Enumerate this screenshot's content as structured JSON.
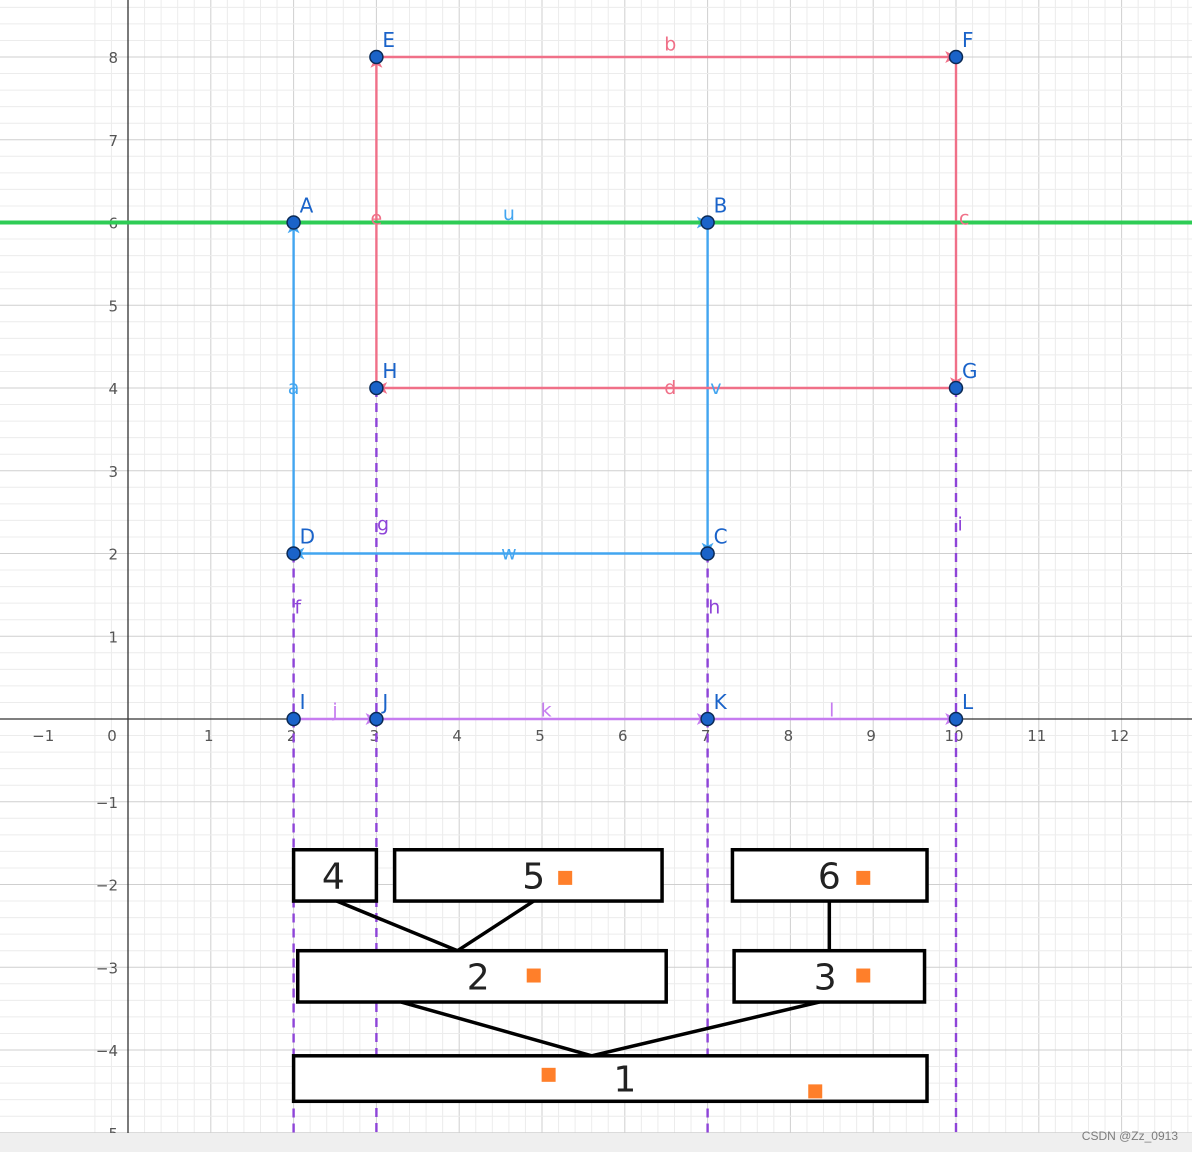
{
  "graph": {
    "x_ticks": [
      -1,
      0,
      1,
      2,
      3,
      4,
      5,
      6,
      7,
      8,
      9,
      10,
      11,
      12
    ],
    "y_ticks": [
      -5,
      -4,
      -3,
      -2,
      -1,
      1,
      2,
      3,
      4,
      5,
      6,
      7,
      8
    ],
    "x_tick_labels": [
      "−1",
      "0",
      "1",
      "2",
      "3",
      "4",
      "5",
      "6",
      "7",
      "8",
      "9",
      "10",
      "11",
      "12"
    ],
    "y_tick_labels": [
      "−5",
      "−4",
      "−3",
      "−2",
      "−1",
      "1",
      "2",
      "3",
      "4",
      "5",
      "6",
      "7",
      "8"
    ],
    "colors": {
      "red": "#f07088",
      "blue": "#42a5f0",
      "purple": "#c67cf0",
      "purple_dashed": "#8e44d8",
      "green": "#2ecc55",
      "point": "#1a63c9",
      "label": "#1a63c9",
      "orange": "#ff7f2a",
      "box": "#000000"
    },
    "points": [
      {
        "name": "A",
        "x": 2,
        "y": 6
      },
      {
        "name": "B",
        "x": 7,
        "y": 6
      },
      {
        "name": "C",
        "x": 7,
        "y": 2
      },
      {
        "name": "D",
        "x": 2,
        "y": 2
      },
      {
        "name": "E",
        "x": 3,
        "y": 8
      },
      {
        "name": "F",
        "x": 10,
        "y": 8
      },
      {
        "name": "G",
        "x": 10,
        "y": 4
      },
      {
        "name": "H",
        "x": 3,
        "y": 4
      },
      {
        "name": "I",
        "x": 2,
        "y": 0
      },
      {
        "name": "J",
        "x": 3,
        "y": 0
      },
      {
        "name": "K",
        "x": 7,
        "y": 0
      },
      {
        "name": "L",
        "x": 10,
        "y": 0
      }
    ],
    "vectors": [
      {
        "name": "a",
        "from": [
          2,
          2
        ],
        "to": [
          2,
          6
        ],
        "color": "blue",
        "lx": 2,
        "ly": 4
      },
      {
        "name": "u",
        "from": [
          2,
          6
        ],
        "to": [
          7,
          6
        ],
        "color": "blue",
        "lx": 4.6,
        "ly": 6.1
      },
      {
        "name": "v",
        "from": [
          7,
          6
        ],
        "to": [
          7,
          2
        ],
        "color": "blue",
        "lx": 7.1,
        "ly": 4
      },
      {
        "name": "w",
        "from": [
          7,
          2
        ],
        "to": [
          2,
          2
        ],
        "color": "blue",
        "lx": 4.6,
        "ly": 2
      },
      {
        "name": "b",
        "from": [
          3,
          8
        ],
        "to": [
          10,
          8
        ],
        "color": "red",
        "lx": 6.55,
        "ly": 8.15
      },
      {
        "name": "c",
        "from": [
          10,
          8
        ],
        "to": [
          10,
          4
        ],
        "color": "red",
        "lx": 10.1,
        "ly": 6.05
      },
      {
        "name": "d",
        "from": [
          10,
          4
        ],
        "to": [
          3,
          4
        ],
        "color": "red",
        "lx": 6.55,
        "ly": 4
      },
      {
        "name": "e",
        "from": [
          3,
          4
        ],
        "to": [
          3,
          8
        ],
        "color": "red",
        "lx": 3,
        "ly": 6.05
      },
      {
        "name": "j",
        "from": [
          2,
          0
        ],
        "to": [
          3,
          0
        ],
        "color": "purple",
        "lx": 2.5,
        "ly": 0.1
      },
      {
        "name": "k",
        "from": [
          3,
          0
        ],
        "to": [
          7,
          0
        ],
        "color": "purple",
        "lx": 5.05,
        "ly": 0.1
      },
      {
        "name": "l",
        "from": [
          7,
          0
        ],
        "to": [
          10,
          0
        ],
        "color": "purple",
        "lx": 8.5,
        "ly": 0.1
      }
    ],
    "dashed_lines": [
      {
        "name": "f",
        "x": 2,
        "lx": 2.05,
        "ly": 1.35
      },
      {
        "name": "g",
        "x": 3,
        "lx": 3.08,
        "ly": 2.35
      },
      {
        "name": "h",
        "x": 7,
        "lx": 7.08,
        "ly": 1.35
      },
      {
        "name": "i",
        "x": 10,
        "lx": 10.05,
        "ly": 2.35
      }
    ],
    "green_line": {
      "y": 6
    },
    "boxes": [
      {
        "label": "4",
        "x1": 2.0,
        "x2": 3.0,
        "y1": -1.58,
        "y2": -2.2,
        "tx": 2.48,
        "markers": []
      },
      {
        "label": "5",
        "x1": 3.22,
        "x2": 6.45,
        "y1": -1.58,
        "y2": -2.2,
        "tx": 4.9,
        "markers": [
          [
            5.28,
            -1.92
          ]
        ]
      },
      {
        "label": "6",
        "x1": 7.3,
        "x2": 9.65,
        "y1": -1.58,
        "y2": -2.2,
        "tx": 8.47,
        "markers": [
          [
            8.88,
            -1.92
          ]
        ]
      },
      {
        "label": "2",
        "x1": 2.05,
        "x2": 6.5,
        "y1": -2.8,
        "y2": -3.42,
        "tx": 4.23,
        "markers": [
          [
            4.9,
            -3.1
          ]
        ]
      },
      {
        "label": "3",
        "x1": 7.32,
        "x2": 9.62,
        "y1": -2.8,
        "y2": -3.42,
        "tx": 8.42,
        "markers": [
          [
            8.88,
            -3.1
          ]
        ]
      },
      {
        "label": "1",
        "x1": 2.0,
        "x2": 9.65,
        "y1": -4.07,
        "y2": -4.62,
        "tx": 6.0,
        "markers": [
          [
            5.08,
            -4.3
          ],
          [
            8.3,
            -4.5
          ]
        ]
      }
    ],
    "connectors": [
      {
        "from": [
          2.52,
          -2.2
        ],
        "to": [
          3.98,
          -2.8
        ]
      },
      {
        "from": [
          4.9,
          -2.2
        ],
        "to": [
          3.98,
          -2.8
        ]
      },
      {
        "from": [
          8.47,
          -2.2
        ],
        "to": [
          8.47,
          -2.8
        ]
      },
      {
        "from": [
          3.3,
          -3.42
        ],
        "to": [
          5.6,
          -4.07
        ]
      },
      {
        "from": [
          8.35,
          -3.42
        ],
        "to": [
          5.6,
          -4.07
        ]
      }
    ]
  },
  "watermark": "CSDN @Zz_0913"
}
